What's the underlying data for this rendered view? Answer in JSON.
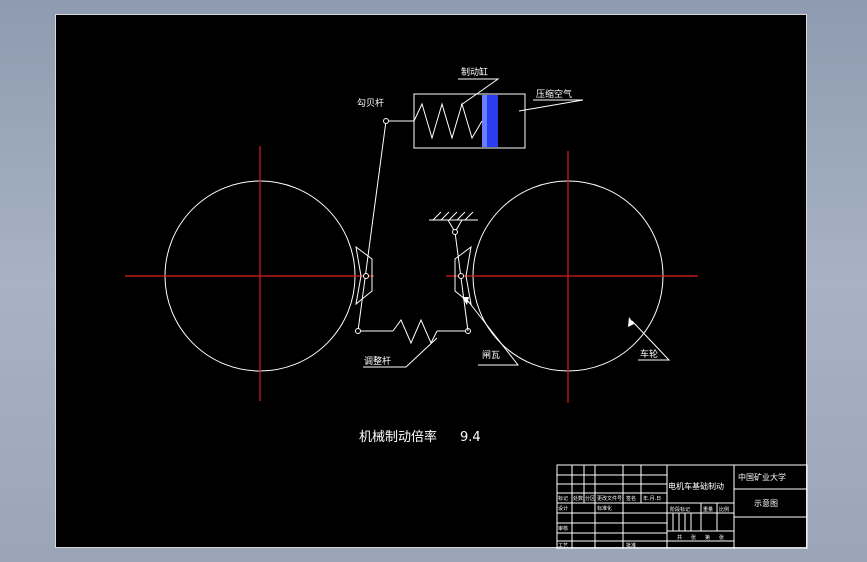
{
  "colors": {
    "background": "#000000",
    "line": "#ffffff",
    "centerline": "#d61d1d",
    "piston": "#2a3cf0"
  },
  "labels": {
    "brake_cylinder": "制动缸",
    "compressed_air": "压缩空气",
    "lever_rod": "勾贝杆",
    "adjust_rod": "调整杆",
    "brake_shoe": "闸瓦",
    "wheel": "车轮",
    "ratio_text": "机械制动倍率",
    "ratio_value": "9.4"
  },
  "title_block": {
    "drawing_title": "电机车基础制动",
    "university": "中国矿业大学",
    "sheet_name": "示意图",
    "cells": {
      "c1": "标记",
      "c2": "处数",
      "c3": "分区",
      "c4": "更改文件号",
      "c5": "签名",
      "c6": "年.月.日",
      "r2a": "设计",
      "r2b": "标准化",
      "r2c": "阶段标记",
      "r2d": "重量",
      "r2e": "比例",
      "r3a": "审核",
      "r4a": "工艺",
      "r4b": "批准",
      "s1": "共",
      "s2": "张",
      "s3": "第",
      "s4": "张"
    }
  }
}
